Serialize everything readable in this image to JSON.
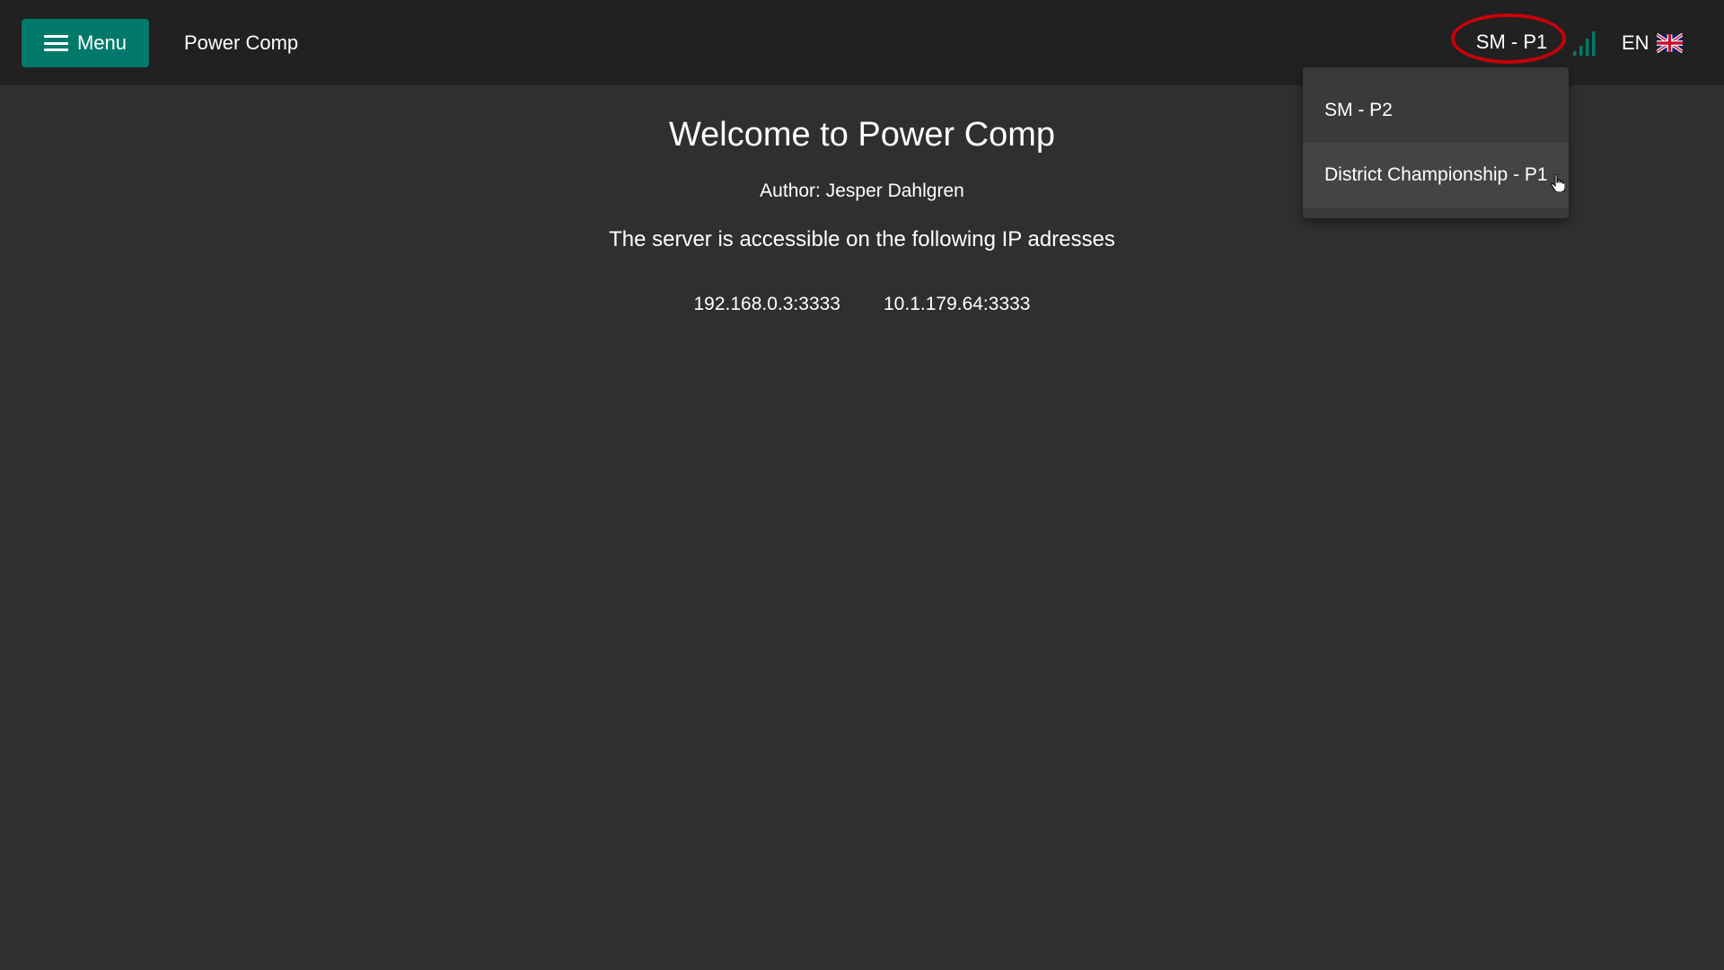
{
  "header": {
    "menu_label": "Menu",
    "app_title": "Power Comp",
    "selected_platform": "SM - P1",
    "language": "EN",
    "signal_icon": "signal-strength-icon",
    "flag_icon": "uk-flag-icon",
    "accent_color": "#00796b",
    "highlight_ring_color": "#c8000a"
  },
  "platform_dropdown": {
    "items": [
      {
        "label": "SM - P2"
      },
      {
        "label": "District Championship - P1"
      }
    ]
  },
  "main": {
    "welcome_title": "Welcome to Power Comp",
    "author": "Author: Jesper Dahlgren",
    "server_text": "The server is accessible on the following IP adresses",
    "ip_addresses": [
      "192.168.0.3:3333",
      "10.1.179.64:3333"
    ]
  }
}
